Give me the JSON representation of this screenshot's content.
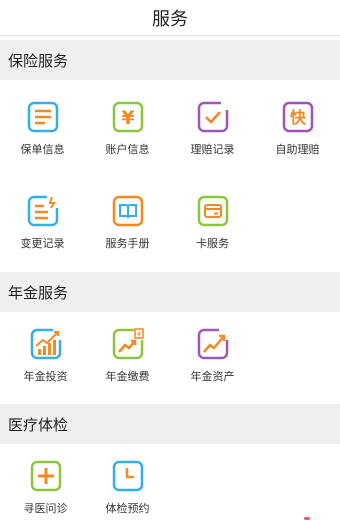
{
  "header": {
    "title": "服务"
  },
  "sections": [
    {
      "title": "保险服务",
      "items": [
        {
          "label": "保单信息",
          "icon": "document-lines-icon",
          "color": "#36b0e0"
        },
        {
          "label": "账户信息",
          "icon": "yuan-icon",
          "color": "#8cc63e"
        },
        {
          "label": "理赔记录",
          "icon": "claim-check-icon",
          "color": "#9b59b6"
        },
        {
          "label": "自助理赔",
          "icon": "fast-kuai-icon",
          "color": "#a450b9"
        },
        {
          "label": "变更记录",
          "icon": "change-record-icon",
          "color": "#36b0e0"
        },
        {
          "label": "服务手册",
          "icon": "book-icon",
          "color": "#f08a24"
        },
        {
          "label": "卡服务",
          "icon": "card-icon",
          "color": "#8cc63e"
        }
      ]
    },
    {
      "title": "年金服务",
      "items": [
        {
          "label": "年金投资",
          "icon": "investment-chart-icon",
          "color": "#36b0e0"
        },
        {
          "label": "年金缴费",
          "icon": "payment-trend-icon",
          "color": "#8cc63e"
        },
        {
          "label": "年金资产",
          "icon": "asset-trend-icon",
          "color": "#9b59b6"
        }
      ]
    },
    {
      "title": "医疗体检",
      "items": [
        {
          "label": "寻医问诊",
          "icon": "medical-cross-icon",
          "color": "#8cc63e"
        },
        {
          "label": "体检预约",
          "icon": "clock-icon",
          "color": "#36b0e0"
        }
      ]
    }
  ],
  "icon_glyphs": {
    "yuan": "¥",
    "kuai": "快"
  },
  "colors": {
    "orange_accent": "#f08a24",
    "section_bg": "#efefef"
  }
}
